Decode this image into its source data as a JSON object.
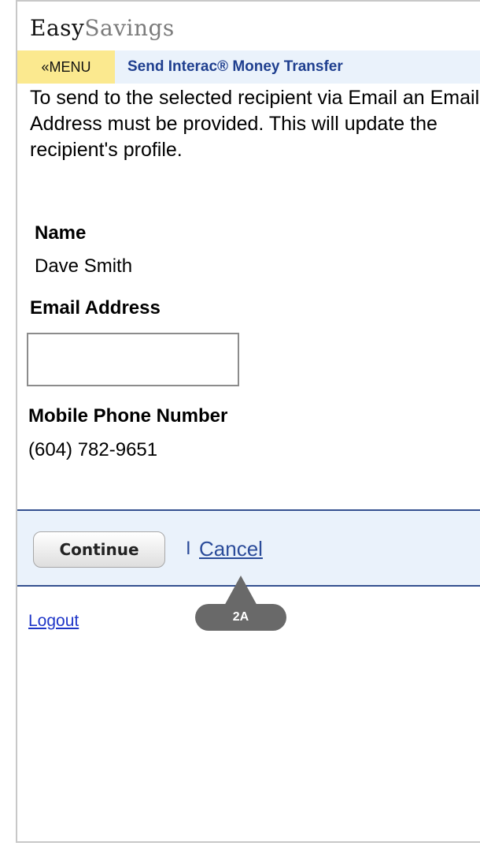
{
  "app": {
    "logo_primary": "Easy",
    "logo_secondary": "Savings"
  },
  "nav": {
    "menu_label": "«MENU",
    "page_title": "Send Interac® Money Transfer"
  },
  "intro_text": "To send to the selected recipient via Email an Email Address must be provided. This will update the recipient's profile.",
  "recipient": {
    "name_label": "Name",
    "name_value": "Dave Smith",
    "email_label": "Email Address",
    "email_value": "",
    "mobile_label": "Mobile Phone Number",
    "mobile_value": "(604) 782-9651"
  },
  "actions": {
    "continue_label": "Continue",
    "separator": "I",
    "cancel_label": "Cancel"
  },
  "footer": {
    "logout_label": "Logout"
  },
  "callout": {
    "label": "2A"
  },
  "colors": {
    "menu_bg": "#fbe98f",
    "nav_bg": "#eaf2fb",
    "nav_title": "#1f3f8f",
    "action_border": "#34508f",
    "link": "#2b4c9a",
    "logout_link": "#1f36c8",
    "callout_bg": "#696969"
  }
}
